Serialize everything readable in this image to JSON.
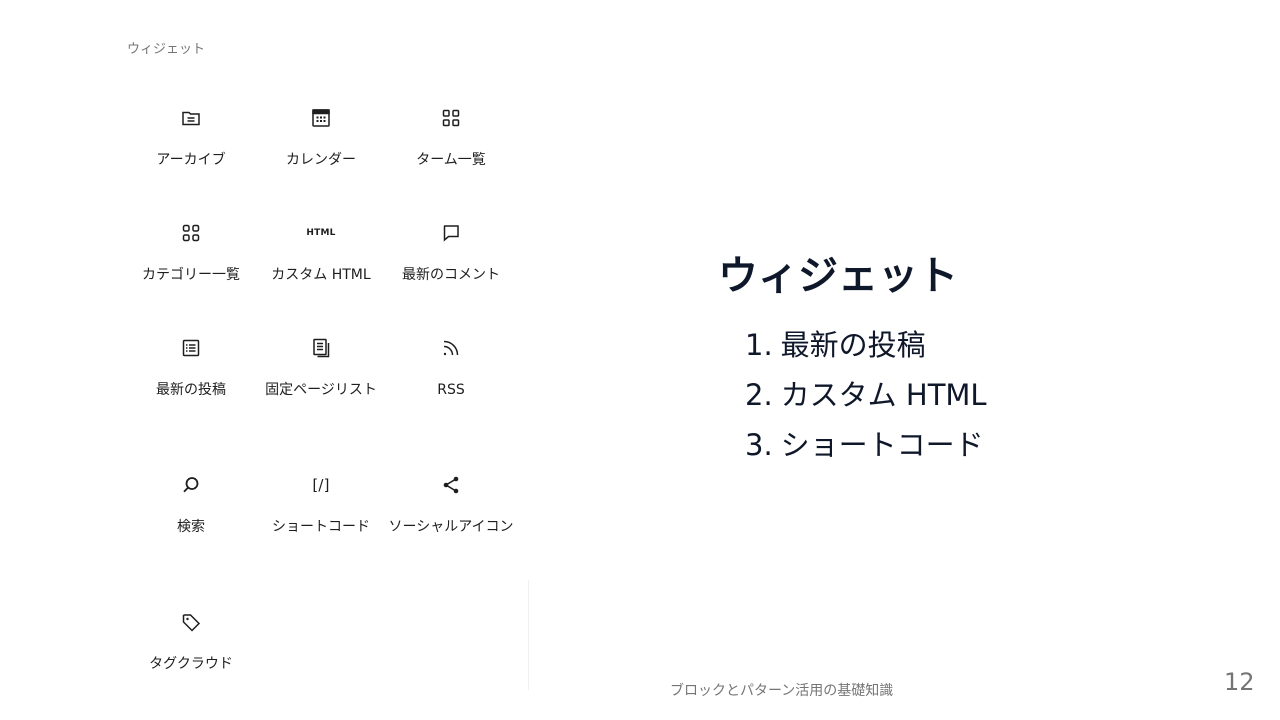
{
  "panel": {
    "title": "ウィジェット",
    "blocks": [
      {
        "label": "アーカイブ",
        "icon": "archive-icon"
      },
      {
        "label": "カレンダー",
        "icon": "calendar-icon"
      },
      {
        "label": "ターム一覧",
        "icon": "terms-list-icon"
      },
      {
        "label": "カテゴリー一覧",
        "icon": "categories-icon"
      },
      {
        "label": "カスタム HTML",
        "icon": "html-icon",
        "icon_text": "HTML"
      },
      {
        "label": "最新のコメント",
        "icon": "comment-icon"
      },
      {
        "label": "最新の投稿",
        "icon": "post-list-icon"
      },
      {
        "label": "固定ページリスト",
        "icon": "pages-icon"
      },
      {
        "label": "RSS",
        "icon": "rss-icon"
      },
      {
        "label": "検索",
        "icon": "search-icon"
      },
      {
        "label": "ショートコード",
        "icon": "shortcode-icon",
        "icon_text": "[/]"
      },
      {
        "label": "ソーシャルアイコン",
        "icon": "share-icon"
      },
      {
        "label": "タグクラウド",
        "icon": "tag-icon"
      }
    ]
  },
  "slide": {
    "heading": "ウィジェット",
    "items": [
      {
        "number": "1.",
        "text": "最新の投稿"
      },
      {
        "number": "2.",
        "text": "カスタム HTML"
      },
      {
        "number": "3.",
        "text": "ショートコード"
      }
    ]
  },
  "footer": {
    "text": "ブロックとパターン活用の基礎知識",
    "page_number": "12"
  }
}
